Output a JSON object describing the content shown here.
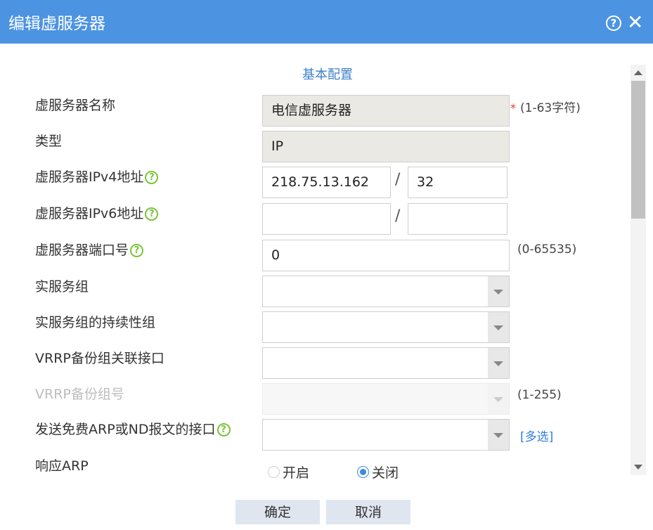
{
  "dialog": {
    "title": "编辑虚服务器",
    "help_symbol": "?",
    "close_symbol": "✕"
  },
  "section_title": "基本配置",
  "fields": {
    "name": {
      "label": "虚服务器名称",
      "value": "电信虚服务器",
      "required_mark": "*",
      "hint": "(1-63字符)"
    },
    "type": {
      "label": "类型",
      "value": "IP"
    },
    "ipv4": {
      "label": "虚服务器IPv4地址",
      "address": "218.75.13.162",
      "mask": "32",
      "separator": "/"
    },
    "ipv6": {
      "label": "虚服务器IPv6地址",
      "address": "",
      "prefix": "",
      "separator": "/"
    },
    "port": {
      "label": "虚服务器端口号",
      "value": "0",
      "hint": "(0-65535)"
    },
    "real_group": {
      "label": "实服务组",
      "value": ""
    },
    "persist_group": {
      "label": "实服务组的持续性组",
      "value": ""
    },
    "vrrp_iface": {
      "label": "VRRP备份组关联接口",
      "value": ""
    },
    "vrrp_group": {
      "label": "VRRP备份组号",
      "value": "",
      "hint": "(1-255)"
    },
    "arp_iface": {
      "label": "发送免费ARP或ND报文的接口",
      "value": "",
      "link": "[多选]"
    },
    "arp_reply": {
      "label": "响应ARP",
      "options": [
        "开启",
        "关闭"
      ],
      "selected": "关闭"
    }
  },
  "help_icon_symbol": "?",
  "buttons": {
    "ok": "确定",
    "cancel": "取消"
  },
  "colors": {
    "title_bar": "#4c93e2",
    "help_icon": "#7cc43b",
    "link": "#2f7ed8",
    "required": "#e53935"
  }
}
